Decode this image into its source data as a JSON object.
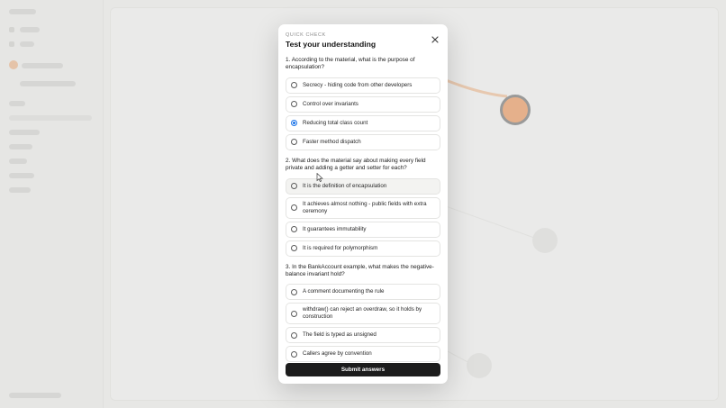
{
  "quiz": {
    "eyebrow": "QUICK CHECK",
    "title": "Test your understanding",
    "close_icon": "close-icon",
    "submit_label": "Submit answers",
    "questions": [
      {
        "text": "1. According to the material, what is the purpose of encapsulation?",
        "options": [
          {
            "label": "Secrecy - hiding code from other developers",
            "selected": false
          },
          {
            "label": "Control over invariants",
            "selected": false
          },
          {
            "label": "Reducing total class count",
            "selected": true
          },
          {
            "label": "Faster method dispatch",
            "selected": false
          }
        ]
      },
      {
        "text": "2. What does the material say about making every field private and adding a getter and setter for each?",
        "options": [
          {
            "label": "It is the definition of encapsulation",
            "selected": false
          },
          {
            "label": "It achieves almost nothing - public fields with extra ceremony",
            "selected": false
          },
          {
            "label": "It guarantees immutability",
            "selected": false
          },
          {
            "label": "It is required for polymorphism",
            "selected": false
          }
        ]
      },
      {
        "text": "3. In the BankAccount example, what makes the negative-balance invariant hold?",
        "options": [
          {
            "label": "A comment documenting the rule",
            "selected": false
          },
          {
            "label": "withdraw() can reject an overdraw, so it holds by construction",
            "selected": false
          },
          {
            "label": "The field is typed as unsigned",
            "selected": false
          },
          {
            "label": "Callers agree by convention",
            "selected": false
          }
        ]
      }
    ]
  },
  "colors": {
    "accent": "#1a73e8",
    "submit_bg": "#1c1c1c",
    "node_orange": "#f07a2a"
  }
}
